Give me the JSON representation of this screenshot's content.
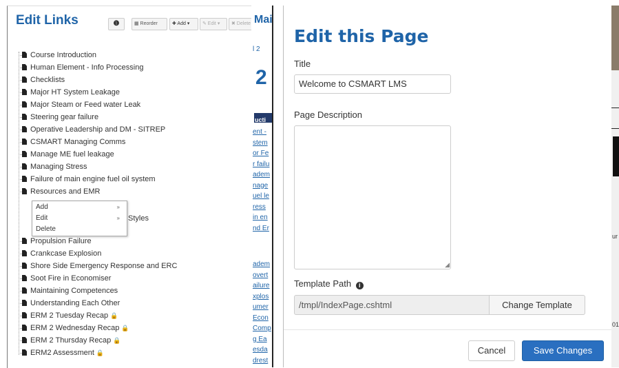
{
  "left_panel": {
    "title": "Edit Links",
    "toolbar": {
      "info_label": "❶",
      "reorder_label": "▦ Reorder",
      "add_label": "✚ Add ▾",
      "edit_label": "✎ Edit ▾",
      "delete_label": "✖ Delete"
    },
    "tree_items": [
      {
        "label": "Course Introduction",
        "locked": false
      },
      {
        "label": "Human Element - Info Processing",
        "locked": false
      },
      {
        "label": "Checklists",
        "locked": false
      },
      {
        "label": "Major HT System Leakage",
        "locked": false
      },
      {
        "label": "Major Steam or Feed water Leak",
        "locked": false
      },
      {
        "label": "Steering gear failure",
        "locked": false
      },
      {
        "label": "Operative Leadership and DM - SITREP",
        "locked": false
      },
      {
        "label": "CSMART Managing Comms",
        "locked": false
      },
      {
        "label": "Manage ME fuel leakage",
        "locked": false
      },
      {
        "label": "Managing Stress",
        "locked": false
      },
      {
        "label": "Failure of main engine fuel oil system",
        "locked": false
      },
      {
        "label": "Resources and EMR",
        "locked": false
      },
      {
        "label": "Propulsion Failure",
        "locked": false
      },
      {
        "label": "Crankcase Explosion",
        "locked": false
      },
      {
        "label": "Shore Side Emergency Response and ERC",
        "locked": false
      },
      {
        "label": "Soot Fire in Economiser",
        "locked": false
      },
      {
        "label": "Maintaining Competences",
        "locked": false
      },
      {
        "label": "Understanding Each Other",
        "locked": false
      },
      {
        "label": "ERM 2 Tuesday Recap",
        "locked": true
      },
      {
        "label": "ERM 2 Wednesday Recap",
        "locked": true
      },
      {
        "label": "ERM 2 Thursday Recap",
        "locked": true
      },
      {
        "label": "ERM2 Assessment",
        "locked": true
      }
    ],
    "context_menu": {
      "items": [
        {
          "label": "Add",
          "arrow": "»"
        },
        {
          "label": "Edit",
          "arrow": "»"
        },
        {
          "label": "Delete",
          "arrow": ""
        }
      ]
    },
    "behind_menu_text": "Styles",
    "lock_glyph": "🔒"
  },
  "middle_strip": {
    "title_fragment": "Mai",
    "tab_fragment": "l 2",
    "big_number": "2",
    "navy_fragment": "ucti",
    "link_fragments": [
      "ent -",
      "stem",
      "or Fe",
      "r failu",
      "adem",
      "nage",
      "uel le",
      "ress",
      "in en",
      "nd Er",
      "adem",
      "overt",
      "ailure",
      "xplos",
      "umer",
      "Econ",
      "Comp",
      "g Ea",
      "esda",
      "drest"
    ]
  },
  "modal": {
    "title": "Edit this Page",
    "title_label": "Title",
    "title_value": "Welcome to CSMART LMS",
    "description_label": "Page Description",
    "description_value": "",
    "template_label": "Template Path",
    "template_value": "/tmpl/IndexPage.cshtml",
    "change_template_label": "Change Template",
    "cancel_label": "Cancel",
    "save_label": "Save Changes"
  },
  "right_strip": {
    "text_a": "ur",
    "text_b": "01"
  }
}
